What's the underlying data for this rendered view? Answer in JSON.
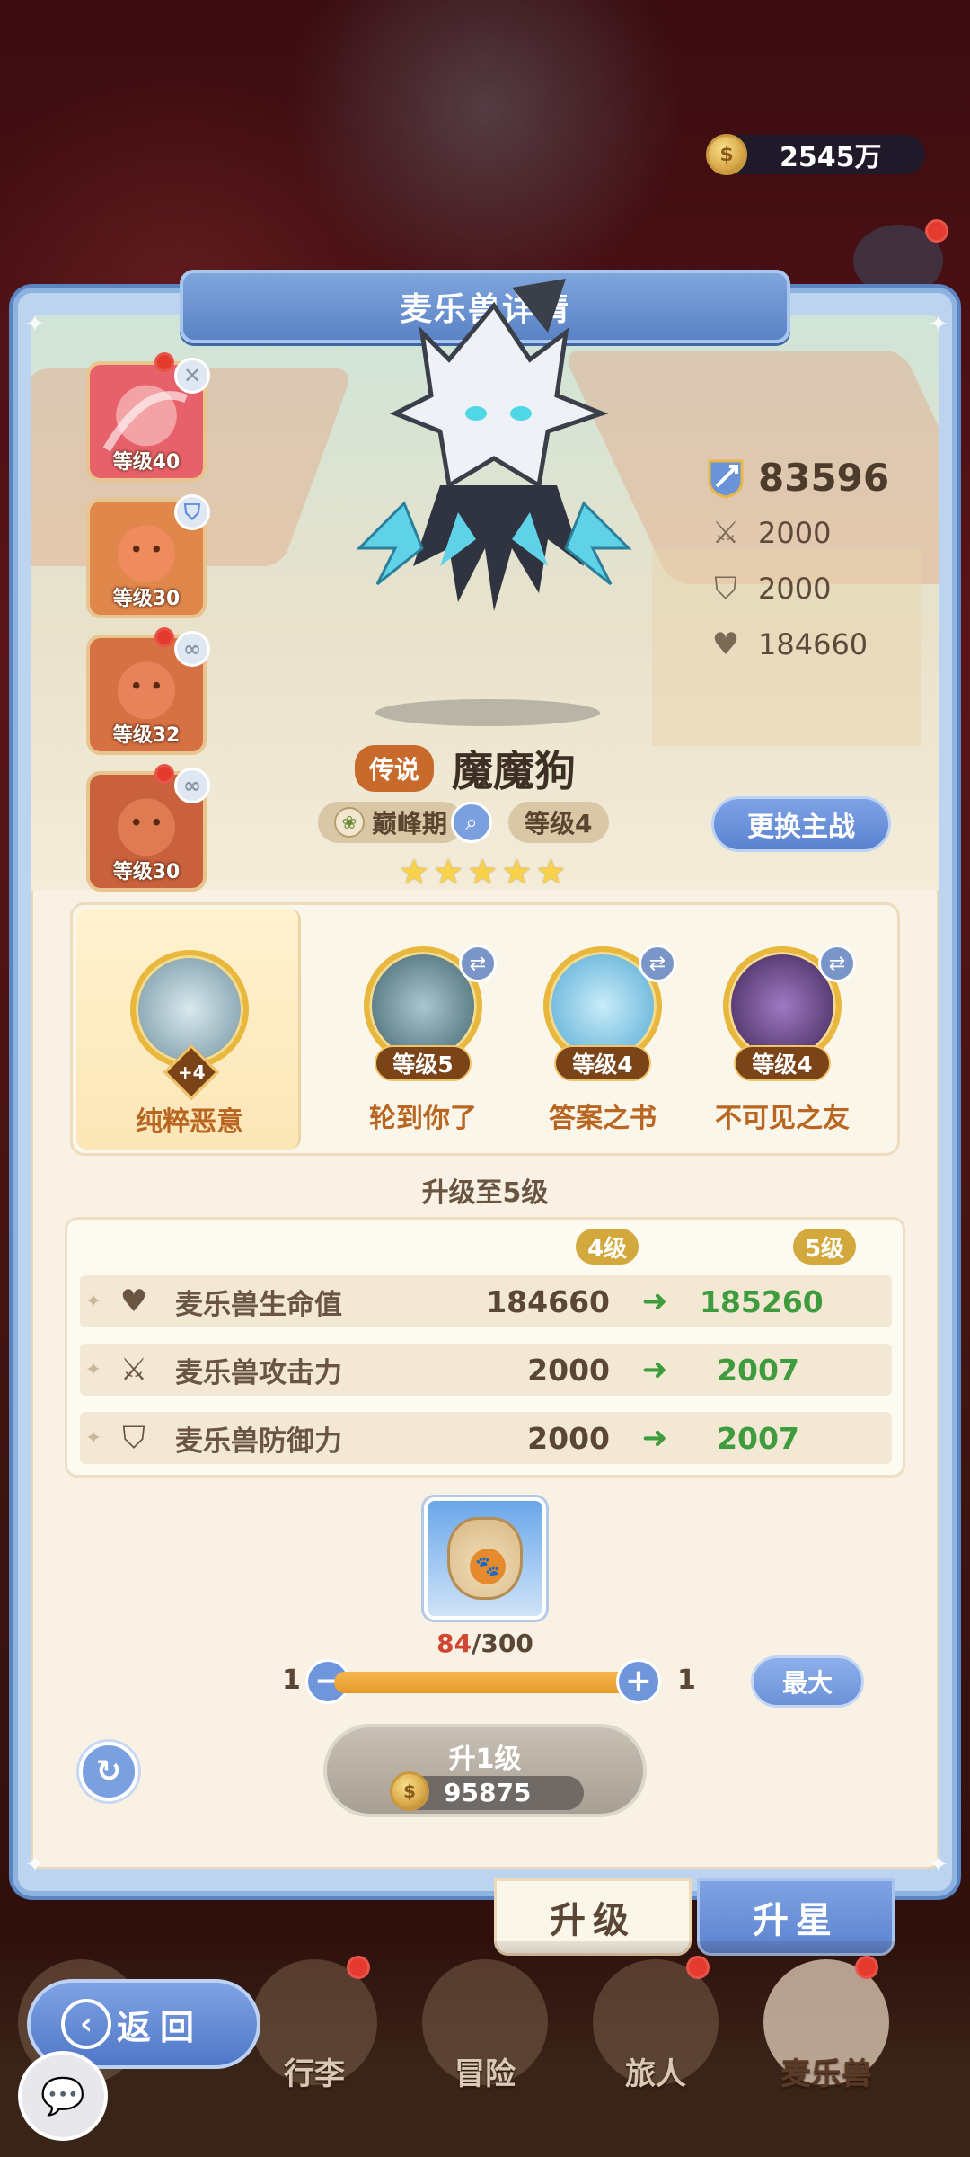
{
  "header": {
    "currency_value": "2545万",
    "currency_icon": "coin-icon"
  },
  "panel": {
    "title": "麦乐兽详情"
  },
  "team": [
    {
      "level_label": "等级40",
      "badge": "close-icon",
      "color": "#e7616b"
    },
    {
      "level_label": "等级30",
      "badge": "shield-icon",
      "color": "#e0874c"
    },
    {
      "level_label": "等级32",
      "badge": "link-icon",
      "color": "#d67143"
    },
    {
      "level_label": "等级30",
      "badge": "link-icon",
      "color": "#c9613d"
    }
  ],
  "monster": {
    "power": "83596",
    "attack": "2000",
    "defense": "2000",
    "hp": "184660",
    "rarity": "传说",
    "name": "魔魔狗",
    "stage": "巅峰期",
    "level": "等级4",
    "stars": 5,
    "swap_label": "更换主战"
  },
  "skills": {
    "main": {
      "name": "纯粹恶意",
      "plus": "+4"
    },
    "list": [
      {
        "name": "轮到你了",
        "level": "等级5",
        "color": "#4d7a86"
      },
      {
        "name": "答案之书",
        "level": "等级4",
        "color": "#79c3ec"
      },
      {
        "name": "不可见之友",
        "level": "等级4",
        "color": "#5b3a7a"
      }
    ]
  },
  "upgrade": {
    "title": "升级至5级",
    "from_level": "4级",
    "to_level": "5级",
    "rows": [
      {
        "icon": "heart-icon",
        "label": "麦乐兽生命值",
        "current": "184660",
        "next": "185260"
      },
      {
        "icon": "swords-icon",
        "label": "麦乐兽攻击力",
        "current": "2000",
        "next": "2007"
      },
      {
        "icon": "shield-icon",
        "label": "麦乐兽防御力",
        "current": "2000",
        "next": "2007"
      }
    ],
    "item_have": "84",
    "item_need": "/300",
    "min": "1",
    "max": "1",
    "fill": 1.0,
    "max_label": "最大",
    "button_label": "升1级",
    "cost": "95875"
  },
  "subtabs": {
    "upgrade": "升级",
    "star": "升星"
  },
  "nav": {
    "back": "返回",
    "items": [
      "行李",
      "冒险",
      "旅人",
      "麦乐兽"
    ]
  }
}
